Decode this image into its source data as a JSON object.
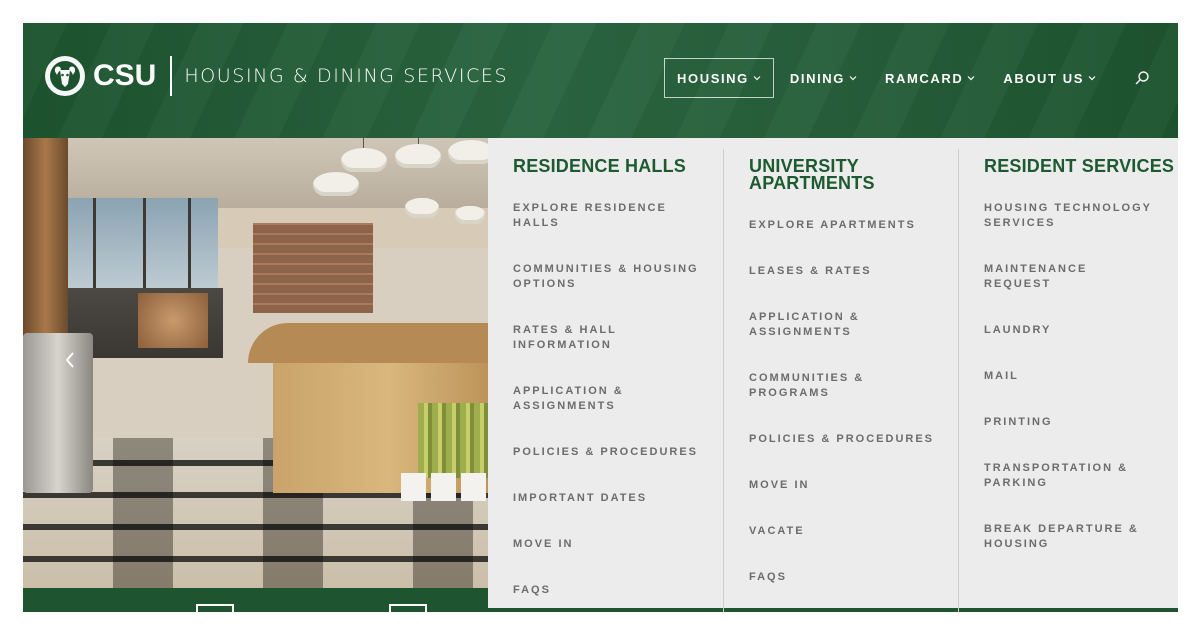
{
  "brand": {
    "logo_text": "CSU",
    "tagline": "HOUSING & DINING SERVICES",
    "logo_icon": "ram-head-icon"
  },
  "nav": {
    "items": [
      {
        "label": "HOUSING",
        "active": true
      },
      {
        "label": "DINING",
        "active": false
      },
      {
        "label": "RAMCARD",
        "active": false
      },
      {
        "label": "ABOUT US",
        "active": false
      }
    ],
    "search_icon": "search-icon"
  },
  "colors": {
    "brand_green": "#1e5a31",
    "header_green": "#1e5430",
    "menu_bg": "#ececec",
    "menu_text": "#6c6c6c"
  },
  "dropdown": {
    "columns": [
      {
        "heading": "RESIDENCE HALLS",
        "items": [
          "EXPLORE RESIDENCE HALLS",
          "COMMUNITIES & HOUSING OPTIONS",
          "RATES & HALL INFORMATION",
          "APPLICATION & ASSIGNMENTS",
          "POLICIES & PROCEDURES",
          "IMPORTANT DATES",
          "MOVE IN",
          "FAQS"
        ]
      },
      {
        "heading": "UNIVERSITY APARTMENTS",
        "items": [
          "EXPLORE APARTMENTS",
          "LEASES & RATES",
          "APPLICATION & ASSIGNMENTS",
          "COMMUNITIES & PROGRAMS",
          "POLICIES & PROCEDURES",
          "MOVE IN",
          "VACATE",
          "FAQS"
        ]
      },
      {
        "heading": "RESIDENT SERVICES",
        "items": [
          "HOUSING TECHNOLOGY SERVICES",
          "MAINTENANCE REQUEST",
          "LAUNDRY",
          "MAIL",
          "PRINTING",
          "TRANSPORTATION & PARKING",
          "BREAK DEPARTURE & HOUSING"
        ]
      }
    ]
  },
  "hero": {
    "prev_icon": "chevron-left-icon"
  }
}
